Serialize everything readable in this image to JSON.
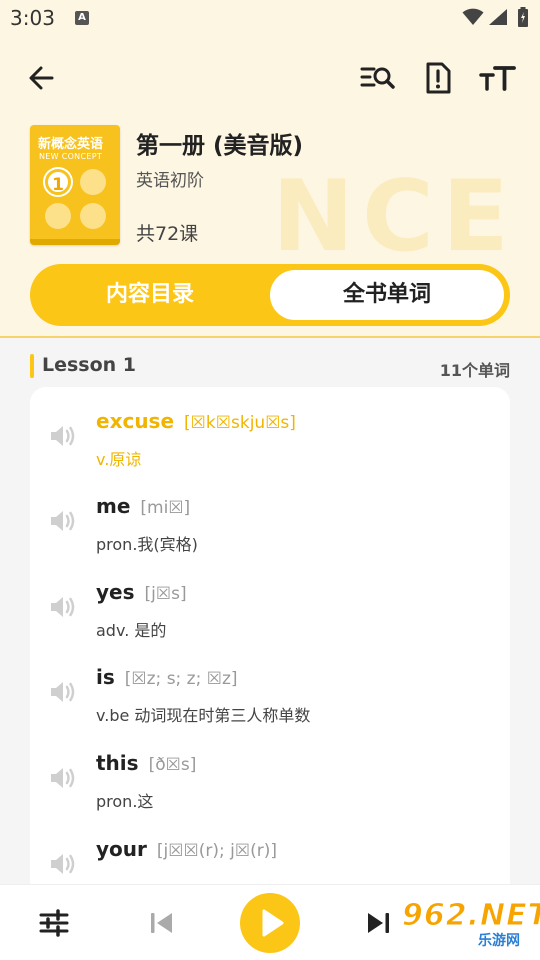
{
  "status_bar": {
    "time": "3:03",
    "notification_badge": "A"
  },
  "toolbar": {
    "icons": [
      "back-arrow-icon",
      "search-list-icon",
      "report-icon",
      "font-size-icon"
    ]
  },
  "book": {
    "cover_title": "新概念英语",
    "cover_subtitle": "NEW CONCEPT",
    "cover_number": "1",
    "title": "第一册 (美音版)",
    "level": "英语初阶",
    "lesson_count": "共72课",
    "watermark": "NCE"
  },
  "tabs": {
    "contents": "内容目录",
    "words": "全书单词",
    "active": "words"
  },
  "lesson": {
    "title": "Lesson 1",
    "word_count": "11个单词"
  },
  "words": [
    {
      "word": "excuse",
      "phonetic": "[☒k☒skju☒s]",
      "meaning": "v.原谅",
      "playing": true
    },
    {
      "word": "me",
      "phonetic": "[mi☒]",
      "meaning": "pron.我(宾格)",
      "playing": false
    },
    {
      "word": "yes",
      "phonetic": "[j☒s]",
      "meaning": "adv. 是的",
      "playing": false
    },
    {
      "word": "is",
      "phonetic": "[☒z; s; z; ☒z]",
      "meaning": "v.be 动词现在时第三人称单数",
      "playing": false
    },
    {
      "word": "this",
      "phonetic": "[ð☒s]",
      "meaning": "pron.这",
      "playing": false
    },
    {
      "word": "your",
      "phonetic": "[j☒☒(r); j☒(r)]",
      "meaning": "",
      "playing": false
    }
  ],
  "player": {
    "icons": [
      "settings-sliders-icon",
      "previous-icon",
      "play-icon",
      "next-icon"
    ]
  },
  "watermark_logo": {
    "main": "962.NET",
    "sub": "乐游网"
  },
  "colors": {
    "accent": "#fcc617",
    "highlight_text": "#f1b500",
    "header_bg": "#fdf6e3"
  }
}
